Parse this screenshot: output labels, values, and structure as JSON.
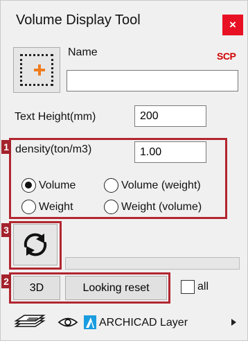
{
  "window": {
    "title": "Volume Display Tool",
    "close_glyph": "×"
  },
  "name_field": {
    "label": "Name",
    "value": "",
    "badge": "SCP"
  },
  "text_height": {
    "label": "Text Height(mm)",
    "value": "200"
  },
  "density": {
    "label": "density(ton/m3)",
    "value": "1.00"
  },
  "display_mode": {
    "options": [
      "Volume",
      "Volume (weight)",
      "Weight",
      "Weight (volume)"
    ],
    "selected": "Volume"
  },
  "markers": [
    "1",
    "2",
    "3"
  ],
  "buttons": {
    "three_d": "3D",
    "looking_reset": "Looking reset"
  },
  "all_checkbox": {
    "label": "all",
    "checked": false
  },
  "layer": {
    "name": "ARCHICAD Layer"
  },
  "icons": [
    "close-icon",
    "add-area-icon",
    "refresh-icon",
    "layers-icon",
    "eye-icon",
    "layer-color-icon",
    "chevron-right-icon"
  ],
  "colors": {
    "close_button": "#e81123",
    "highlight": "#b22630",
    "scp_badge": "#d40000",
    "plus_accent": "#f07c1e",
    "layer_swatch": "#1a9ce0"
  },
  "progress": {
    "fraction": 0
  }
}
